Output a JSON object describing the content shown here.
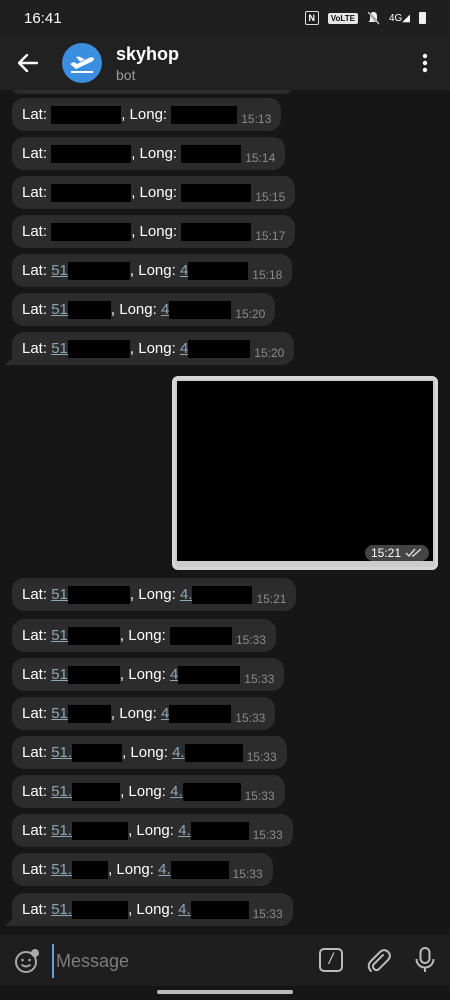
{
  "status_bar": {
    "time": "16:41",
    "volte_label": "VoLTE",
    "signal_label": "4G"
  },
  "header": {
    "title": "skyhop",
    "subtitle": "bot"
  },
  "messages": [
    {
      "lat_label": "Lat:",
      "lat_prefix": "",
      "long_label": ", Long:",
      "long_prefix": "",
      "time": "15:13"
    },
    {
      "lat_label": "Lat:",
      "lat_prefix": "",
      "long_label": ", Long:",
      "long_prefix": "",
      "time": "15:14"
    },
    {
      "lat_label": "Lat:",
      "lat_prefix": "",
      "long_label": ", Long:",
      "long_prefix": "",
      "time": "15:15"
    },
    {
      "lat_label": "Lat:",
      "lat_prefix": "",
      "long_label": ", Long:",
      "long_prefix": "",
      "time": "15:17"
    },
    {
      "lat_label": "Lat:",
      "lat_prefix": "51",
      "long_label": ", Long:",
      "long_prefix": "4",
      "time": "15:18"
    },
    {
      "lat_label": "Lat:",
      "lat_prefix": "51",
      "long_label": ", Long:",
      "long_prefix": "4",
      "time": "15:20"
    },
    {
      "lat_label": "Lat:",
      "lat_prefix": "51",
      "long_label": ", Long:",
      "long_prefix": "4",
      "time": "15:20"
    },
    {
      "lat_label": "Lat:",
      "lat_prefix": "51",
      "long_label": ", Long:",
      "long_prefix": "4.",
      "time": "15:21"
    },
    {
      "lat_label": "Lat:",
      "lat_prefix": "51",
      "long_label": ", Long:",
      "long_prefix": "",
      "time": "15:33"
    },
    {
      "lat_label": "Lat:",
      "lat_prefix": "51",
      "long_label": ", Long:",
      "long_prefix": "4",
      "time": "15:33"
    },
    {
      "lat_label": "Lat:",
      "lat_prefix": "51",
      "long_label": ", Long:",
      "long_prefix": "4",
      "time": "15:33"
    },
    {
      "lat_label": "Lat:",
      "lat_prefix": "51.",
      "long_label": ", Long:",
      "long_prefix": "4.",
      "time": "15:33"
    },
    {
      "lat_label": "Lat:",
      "lat_prefix": "51.",
      "long_label": ", Long:",
      "long_prefix": "4.",
      "time": "15:33"
    },
    {
      "lat_label": "Lat:",
      "lat_prefix": "51.",
      "long_label": ", Long:",
      "long_prefix": "4.",
      "time": "15:33"
    },
    {
      "lat_label": "Lat:",
      "lat_prefix": "51.",
      "long_label": ", Long:",
      "long_prefix": "4.",
      "time": "15:33"
    },
    {
      "lat_label": "Lat:",
      "lat_prefix": "51.",
      "long_label": ", Long:",
      "long_prefix": "4.",
      "time": "15:33"
    }
  ],
  "photo_message": {
    "time": "15:21"
  },
  "composer": {
    "placeholder": "Message"
  },
  "colors": {
    "accent": "#3b8ee0",
    "bubble": "#2c2c2c",
    "link": "#8ea7b8"
  }
}
